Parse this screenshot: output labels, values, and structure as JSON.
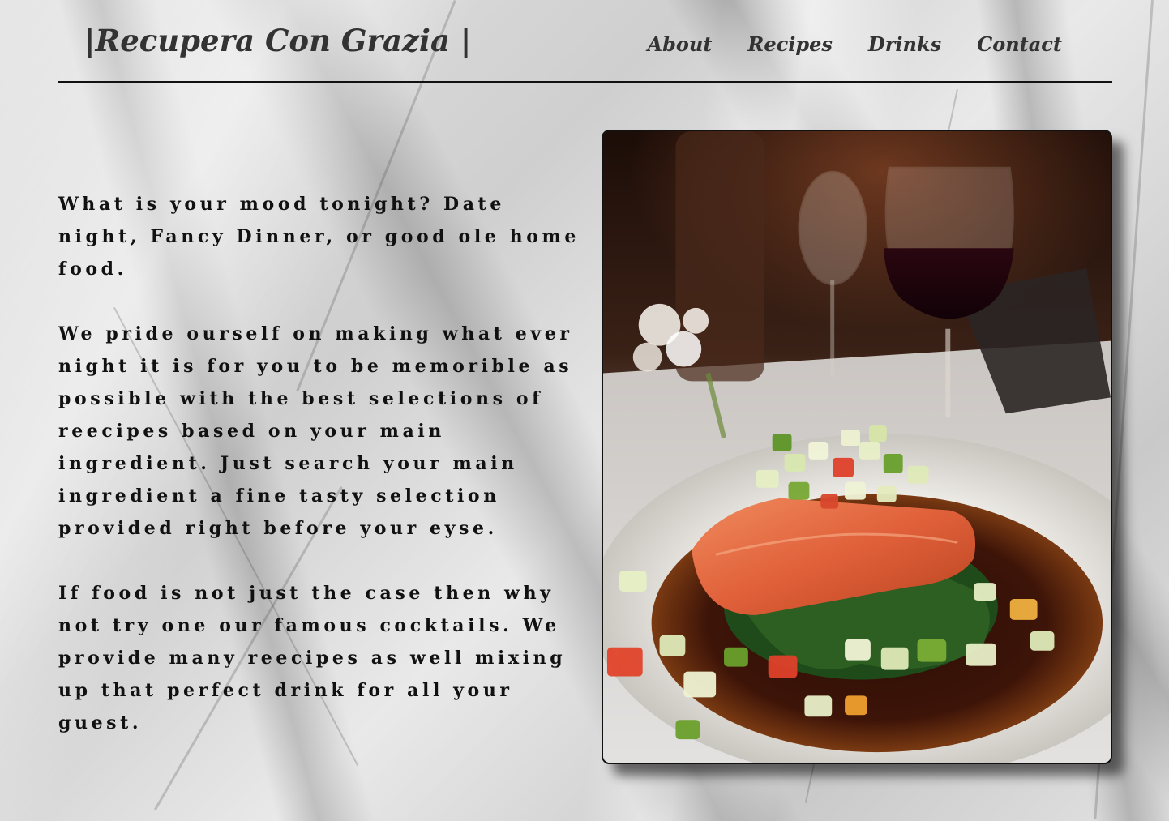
{
  "brand": {
    "title": "|Recupera Con Grazia |"
  },
  "nav": {
    "items": [
      {
        "label": "About"
      },
      {
        "label": "Recipes"
      },
      {
        "label": "Drinks"
      },
      {
        "label": "Contact"
      }
    ]
  },
  "intro": {
    "paragraphs": [
      "What is your mood tonight? Date night, Fancy Dinner, or good ole home food.",
      "We pride ourself on making what ever night it is for you to be memorible as possible with the best selections of reecipes based on your main ingredient. Just search your main ingredient a fine tasty selection provided right before your eyse.",
      "If food is not just the case then why not try one our famous cocktails.  We provide many reecipes as well mixing up that perfect drink for all your guest."
    ]
  },
  "hero_image": {
    "subject": "plated salmon with vegetables and red wine glasses"
  },
  "colors": {
    "text": "#111111",
    "heading": "#333333",
    "divider": "#111111"
  }
}
